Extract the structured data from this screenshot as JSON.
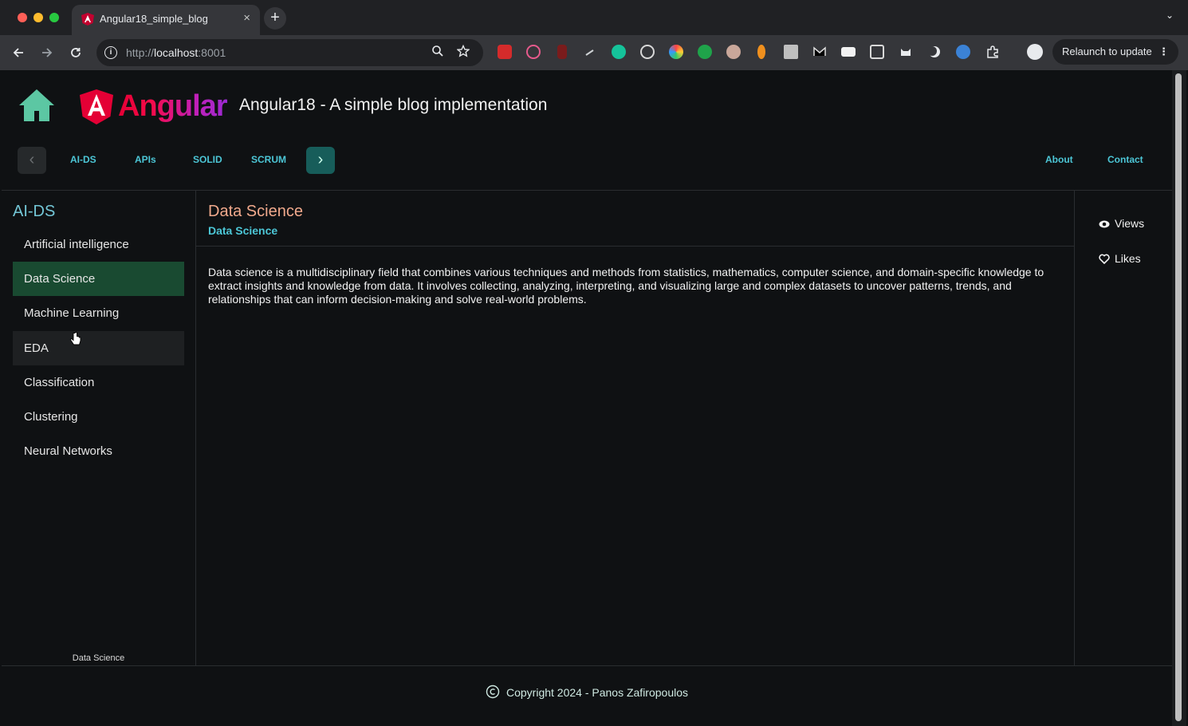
{
  "browser": {
    "tab_title": "Angular18_simple_blog",
    "tab_close": "×",
    "new_tab": "+",
    "tab_menu": "⌄",
    "url_prefix": "http://",
    "url_host": "localhost",
    "url_port": ":8001",
    "relaunch_label": "Relaunch to update",
    "relaunch_menu": "⋮",
    "extensions": [
      "abp",
      "circle",
      "pdf",
      "pen",
      "grammarly",
      "wire",
      "color",
      "green",
      "eyes",
      "drop",
      "image",
      "m-logo",
      "markdown",
      "reader",
      "cat",
      "moon",
      "cloud",
      "puzzle"
    ]
  },
  "header": {
    "logo_text": "Angular",
    "site_title": "Angular18 - A simple blog implementation"
  },
  "navbar": {
    "prev": "‹",
    "next": "›",
    "links": [
      "AI-DS",
      "APIs",
      "SOLID",
      "SCRUM"
    ],
    "right_links": [
      "About",
      "Contact"
    ]
  },
  "sidebar": {
    "title": "AI-DS",
    "items": [
      {
        "label": "Artificial intelligence"
      },
      {
        "label": "Data Science"
      },
      {
        "label": "Machine Learning"
      },
      {
        "label": "EDA"
      },
      {
        "label": "Classification"
      },
      {
        "label": "Clustering"
      },
      {
        "label": "Neural Networks"
      }
    ],
    "active": "Data Science",
    "footer": "Data Science"
  },
  "content": {
    "title": "Data Science",
    "subtitle": "Data Science",
    "body": "Data science is a multidisciplinary field that combines various techniques and methods from statistics, mathematics, computer science, and domain-specific knowledge to extract insights and knowledge from data. It involves collecting, analyzing, interpreting, and visualizing large and complex datasets to uncover patterns, trends, and relationships that can inform decision-making and solve real-world problems."
  },
  "actions": {
    "views_label": "Views",
    "likes_label": "Likes"
  },
  "footer": {
    "copyright": "Copyright 2024 - Panos Zafiropoulos"
  },
  "colors": {
    "accent": "#4cc6d6",
    "active_item": "#194a31",
    "title_peach": "#f0a98c",
    "next_button": "#175d5a"
  }
}
